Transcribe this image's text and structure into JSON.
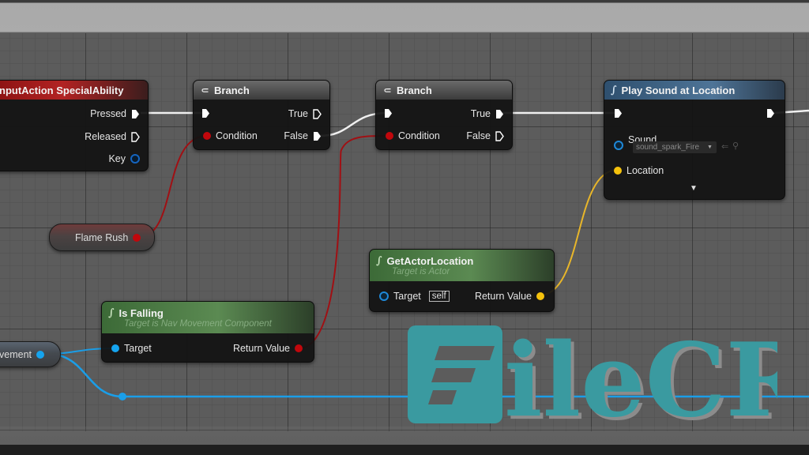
{
  "app": "Unreal Engine Blueprint Editor",
  "colors": {
    "exec_wire": "#ffffff",
    "bool_wire": "#a01014",
    "vector_wire": "#e8b62a",
    "object_wire": "#1a9ee8",
    "event_header": "#b22323",
    "function_header": "#4e7497",
    "pure_header": "#5b8a52"
  },
  "nodes": {
    "input_action": {
      "title": "InputAction SpecialAbility",
      "title_visible": "nputAction SpecialAbility",
      "pins": {
        "pressed": "Pressed",
        "released": "Released",
        "key": "Key"
      }
    },
    "branch1": {
      "title": "Branch",
      "icon": "branch-icon",
      "pins": {
        "condition": "Condition",
        "true": "True",
        "false": "False"
      }
    },
    "branch2": {
      "title": "Branch",
      "icon": "branch-icon",
      "pins": {
        "condition": "Condition",
        "true": "True",
        "false": "False"
      }
    },
    "play_sound": {
      "title": "Play Sound at Location",
      "icon": "function-icon",
      "pins": {
        "sound": "Sound",
        "location": "Location"
      },
      "sound_value": "sound_spark_Fire",
      "sound_value_visible": "sound_spark_Fire",
      "expand_icon": "advanced-pins-arrow"
    },
    "flame_rush": {
      "label": "Flame Rush"
    },
    "get_actor_location": {
      "title": "GetActorLocation",
      "subtitle": "Target is Actor",
      "pins": {
        "target": "Target",
        "target_default": "self",
        "return": "Return Value"
      }
    },
    "is_falling": {
      "title": "Is Falling",
      "subtitle": "Target is Nav Movement Component",
      "pins": {
        "target": "Target",
        "return": "Return Value"
      }
    },
    "movement_var": {
      "label_visible": "vement"
    }
  },
  "watermark": {
    "text": "FileCR",
    "letters": "ileCR",
    "color": "#3a9aa0"
  }
}
